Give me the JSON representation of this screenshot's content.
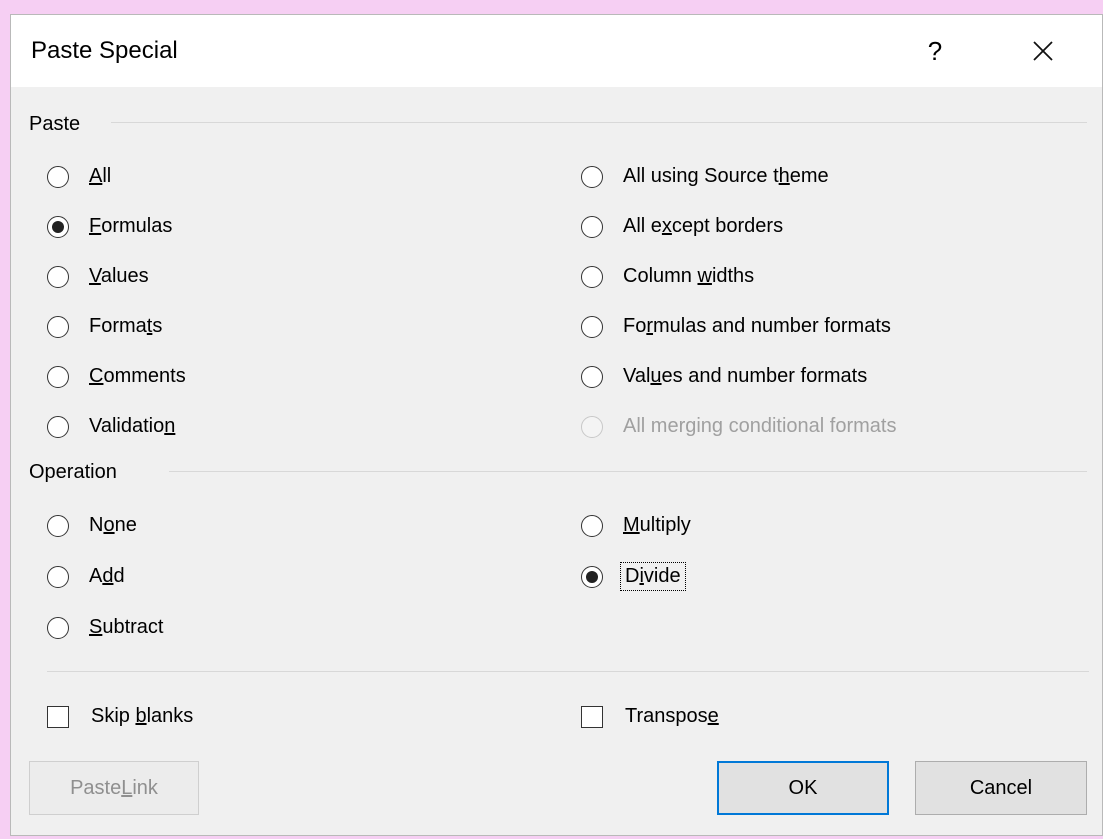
{
  "dialog": {
    "title": "Paste Special",
    "help_label": "?",
    "icons": {
      "close": "close-icon"
    }
  },
  "paste": {
    "label": "Paste",
    "left_options": [
      {
        "pre": "",
        "key": "A",
        "post": "ll",
        "checked": false
      },
      {
        "pre": "",
        "key": "F",
        "post": "ormulas",
        "checked": true
      },
      {
        "pre": "",
        "key": "V",
        "post": "alues",
        "checked": false
      },
      {
        "pre": "Forma",
        "key": "t",
        "post": "s",
        "checked": false
      },
      {
        "pre": "",
        "key": "C",
        "post": "omments",
        "checked": false
      },
      {
        "pre": "Validatio",
        "key": "n",
        "post": "",
        "checked": false
      }
    ],
    "right_options": [
      {
        "pre": "All using Source t",
        "key": "h",
        "post": "eme",
        "checked": false,
        "disabled": false
      },
      {
        "pre": "All e",
        "key": "x",
        "post": "cept borders",
        "checked": false,
        "disabled": false
      },
      {
        "pre": "Column ",
        "key": "w",
        "post": "idths",
        "checked": false,
        "disabled": false
      },
      {
        "pre": "Fo",
        "key": "r",
        "post": "mulas and number formats",
        "checked": false,
        "disabled": false
      },
      {
        "pre": "Val",
        "key": "u",
        "post": "es and number formats",
        "checked": false,
        "disabled": false
      },
      {
        "pre": "All mer",
        "key": "g",
        "post": "ing conditional formats",
        "checked": false,
        "disabled": true
      }
    ]
  },
  "operation": {
    "label": "Operation",
    "left_options": [
      {
        "pre": "N",
        "key": "o",
        "post": "ne",
        "checked": false
      },
      {
        "pre": "A",
        "key": "d",
        "post": "d",
        "checked": false
      },
      {
        "pre": "",
        "key": "S",
        "post": "ubtract",
        "checked": false
      }
    ],
    "right_options": [
      {
        "pre": "",
        "key": "M",
        "post": "ultiply",
        "checked": false
      },
      {
        "pre": "D",
        "key": "i",
        "post": "vide",
        "checked": true
      }
    ]
  },
  "checkboxes": {
    "skip_blanks": {
      "pre": "Skip ",
      "key": "b",
      "post": "lanks",
      "checked": false
    },
    "transpose": {
      "pre": "Transpos",
      "key": "e",
      "post": "",
      "checked": false
    }
  },
  "buttons": {
    "paste_link": {
      "pre": "Paste ",
      "key": "L",
      "post": "ink"
    },
    "ok": "OK",
    "cancel": "Cancel"
  },
  "colors": {
    "background": "#f6cff3",
    "dialog": "#f0f0f0",
    "accent": "#0078d7"
  }
}
